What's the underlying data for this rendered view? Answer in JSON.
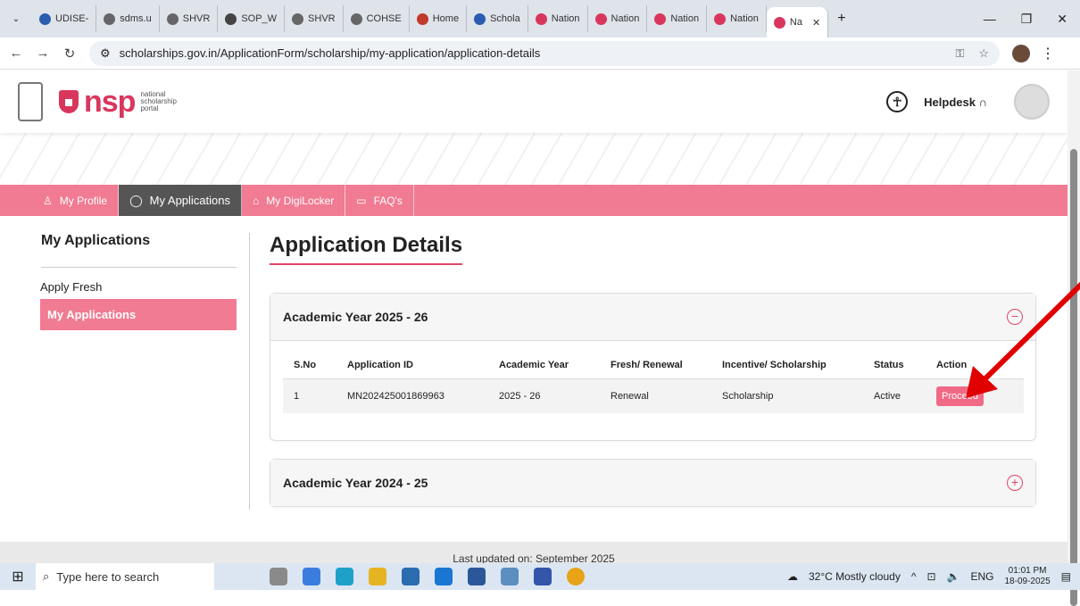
{
  "browser": {
    "tabs": [
      {
        "label": "UDISE-",
        "color": "#2a5db0"
      },
      {
        "label": "sdms.u",
        "color": "#666"
      },
      {
        "label": "SHVR",
        "color": "#666"
      },
      {
        "label": "SOP_W",
        "color": "#444"
      },
      {
        "label": "SHVR",
        "color": "#666"
      },
      {
        "label": "COHSE",
        "color": "#666"
      },
      {
        "label": "Home",
        "color": "#c0392b"
      },
      {
        "label": "Schola",
        "color": "#2a5db0"
      },
      {
        "label": "Nation",
        "color": "#d9365e"
      },
      {
        "label": "Nation",
        "color": "#d9365e"
      },
      {
        "label": "Nation",
        "color": "#d9365e"
      },
      {
        "label": "Nation",
        "color": "#d9365e"
      },
      {
        "label": "Na",
        "color": "#d9365e"
      }
    ],
    "url": "scholarships.gov.in/ApplicationForm/scholarship/my-application/application-details"
  },
  "header": {
    "logo": "nsp",
    "tagline1": "national",
    "tagline2": "scholarship",
    "tagline3": "portal",
    "helpdesk": "Helpdesk"
  },
  "menu": [
    {
      "label": "My Profile",
      "icon": "♙"
    },
    {
      "label": "My Applications",
      "icon": "◯",
      "active": true
    },
    {
      "label": "My DigiLocker",
      "icon": "⌂"
    },
    {
      "label": "FAQ's",
      "icon": "▭"
    }
  ],
  "sidebar": {
    "title": "My Applications",
    "items": [
      {
        "label": "Apply Fresh"
      },
      {
        "label": "My Applications"
      }
    ]
  },
  "main": {
    "title": "Application Details"
  },
  "panels": [
    {
      "title": "Academic Year 2025 - 26",
      "toggle": "−"
    },
    {
      "title": "Academic Year 2024 - 25",
      "toggle": "+"
    }
  ],
  "table": {
    "headers": [
      "S.No",
      "Application ID",
      "Academic Year",
      "Fresh/ Renewal",
      "Incentive/ Scholarship",
      "Status",
      "Action"
    ],
    "row": {
      "sno": "1",
      "app_id": "MN202425001869963",
      "year": "2025 - 26",
      "type": "Renewal",
      "scheme": "Scholarship",
      "status": "Active",
      "action": "Proceed"
    }
  },
  "footer": "Last updated on: September 2025",
  "taskbar": {
    "search": "Type here to search",
    "weather": "32°C  Mostly cloudy",
    "lang": "ENG",
    "time": "01:01 PM",
    "date": "18-09-2025"
  }
}
